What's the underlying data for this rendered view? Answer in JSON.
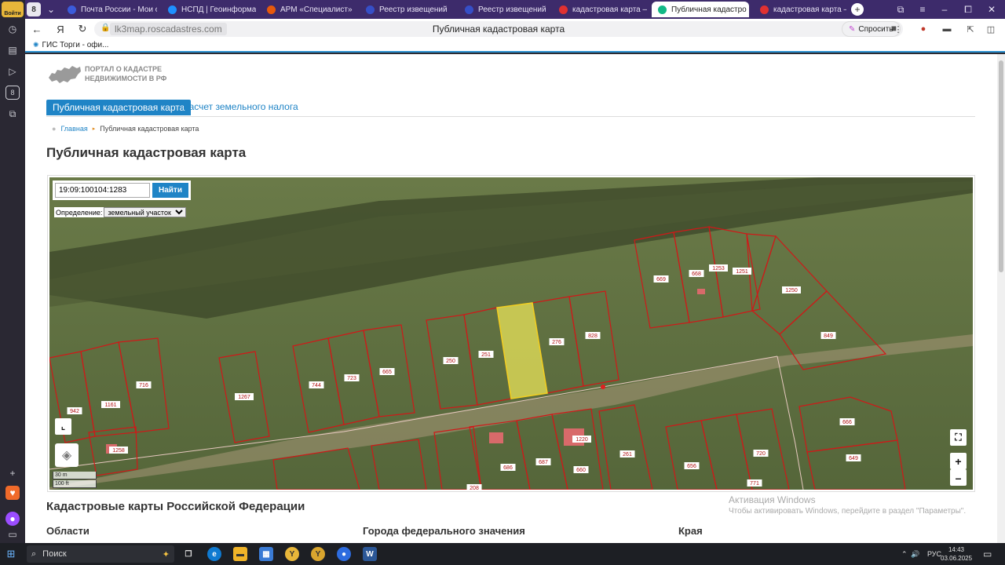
{
  "sidebar": {
    "login_label": "Войти"
  },
  "tabs": [
    {
      "label": "Почта России - Мои отп",
      "color": "#3b5bdb"
    },
    {
      "label": "НСПД | Геоинформаци",
      "color": "#1e90ff"
    },
    {
      "label": "АРМ «Специалист»",
      "color": "#e8590c"
    },
    {
      "label": "Реестр извещений",
      "color": "#364fc7"
    },
    {
      "label": "Реестр извещений",
      "color": "#364fc7"
    },
    {
      "label": "кадастровая карта — Я",
      "color": "#e03131"
    },
    {
      "label": "Публичная кадастро",
      "color": "#12b886",
      "active": true
    },
    {
      "label": "кадастровая карта — Я",
      "color": "#e03131"
    }
  ],
  "tab_counter": "8",
  "address": {
    "url": "lk3map.roscadastres.com",
    "title": "Публичная кадастровая карта",
    "ask_label": "Спросить"
  },
  "bookmarks": [
    {
      "label": "ГИС Торги - офи..."
    }
  ],
  "header": {
    "logo_line1": "ПОРТАЛ О КАДАСТРЕ",
    "logo_line2": "НЕДВИЖИМОСТИ В РФ"
  },
  "nav": {
    "active": "Публичная кадастровая карта",
    "other": "Расчет земельного налога"
  },
  "breadcrumb": {
    "home": "Главная",
    "current": "Публичная кадастровая карта"
  },
  "page_title": "Публичная кадастровая карта",
  "map": {
    "search_value": "19:09:100104:1283",
    "search_button": "Найти",
    "definition_label": "Определение:",
    "definition_value": "земельный участок",
    "scale_m": "30 m",
    "scale_ft": "100 ft",
    "parcel_labels": [
      "942",
      "1161",
      "716",
      "1258",
      "1267",
      "744",
      "723",
      "665",
      "250",
      "251",
      "276",
      "828",
      "669",
      "668",
      "1253",
      "1251",
      "1250",
      "849",
      "666",
      "649",
      "261",
      "656",
      "720",
      "771",
      "687",
      "686",
      "660",
      "1220",
      "208"
    ],
    "colors": {
      "boundary": "#d01818",
      "selected_fill": "#e8e35a",
      "label_bg": "#ffffff",
      "road": "#c7b49a"
    }
  },
  "sections": {
    "title": "Кадастровые карты Российской Федерации",
    "col1": "Области",
    "col2": "Города федерального значения",
    "col3": "Края"
  },
  "activation": {
    "line1": "Активация Windows",
    "line2": "Чтобы активировать Windows, перейдите в раздел \"Параметры\"."
  },
  "taskbar": {
    "search": "Поиск",
    "lang": "РУС",
    "time": "14:43",
    "date": "03.06.2025"
  }
}
